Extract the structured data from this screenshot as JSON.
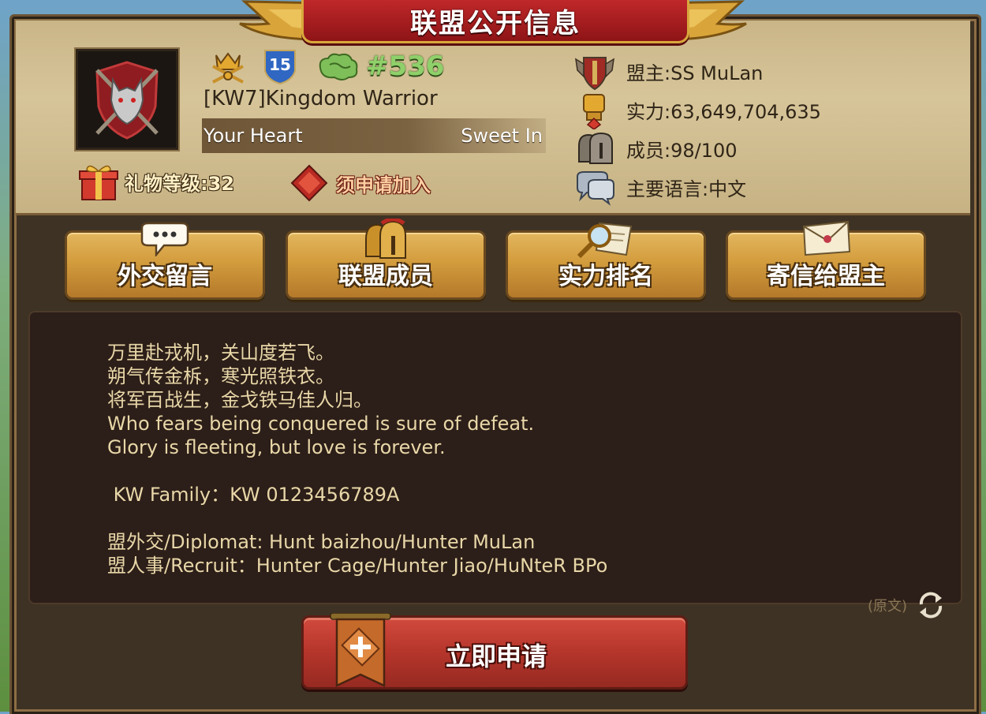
{
  "header": {
    "title": "联盟公开信息"
  },
  "alliance": {
    "level_badge": "15",
    "rank": "#536",
    "name": "[KW7]Kingdom  Warrior",
    "motto_left": "Your Heart",
    "motto_right": "Sweet In",
    "gift_level": "礼物等级:32",
    "join_requirement": "须申请加入"
  },
  "stats": {
    "leader": "盟主:SS MuLan",
    "power": "实力:63,649,704,635",
    "members": "成员:98/100",
    "language": "主要语言:中文"
  },
  "actions": {
    "diplomacy": "外交留言",
    "members": "联盟成员",
    "ranking": "实力排名",
    "mail_leader": "寄信给盟主"
  },
  "description": {
    "lines": [
      "万里赴戎机，关山度若飞。",
      "朔气传金柝，寒光照铁衣。",
      "将军百战生，金戈铁马佳人归。",
      "Who fears being conquered is sure of defeat.",
      "Glory is fleeting, but love is forever.",
      "",
      " KW Family：KW 0123456789A",
      "",
      "盟外交/Diplomat: Hunt baizhou/Hunter MuLan",
      "盟人事/Recruit：Hunter Cage/Hunter Jiao/HuNteR BPo"
    ]
  },
  "translate": {
    "label": "(原文)"
  },
  "join_button": {
    "label": "立即申请"
  },
  "colors": {
    "parchment": "#d7c59a",
    "dark_panel": "#2c1e18",
    "gold_button": "#d39c3d",
    "red_button": "#b5352b",
    "rank_green": "#8fd06a",
    "title_red": "#c0282a"
  }
}
